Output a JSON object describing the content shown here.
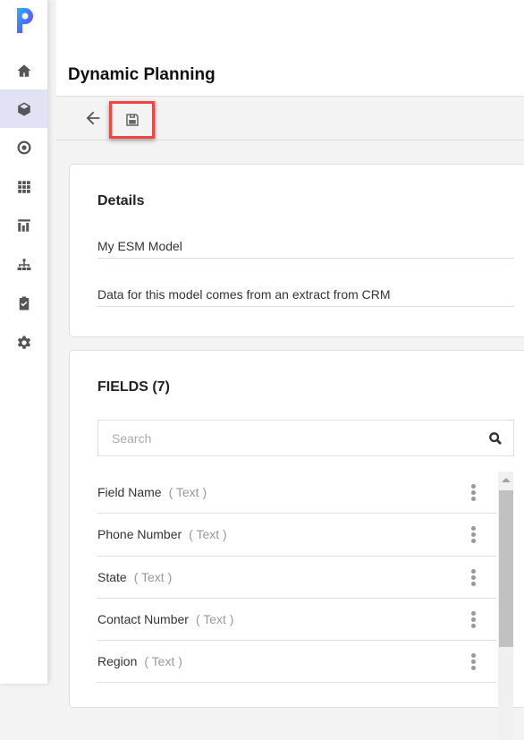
{
  "app": {
    "title": "Dynamic Planning",
    "accent": "#5b3df5"
  },
  "sidebar": {
    "items": [
      {
        "icon": "home-icon"
      },
      {
        "icon": "cube-icon",
        "active": true
      },
      {
        "icon": "target-icon"
      },
      {
        "icon": "grid-icon"
      },
      {
        "icon": "chart-icon"
      },
      {
        "icon": "hierarchy-icon"
      },
      {
        "icon": "clipboard-check-icon"
      },
      {
        "icon": "gear-icon"
      }
    ]
  },
  "toolbar": {
    "back": "arrow-left-icon",
    "save": "save-icon",
    "highlight": "#f04444"
  },
  "details": {
    "heading": "Details",
    "name": "My ESM Model",
    "description": "Data for this model comes from an extract from CRM"
  },
  "fields": {
    "heading": "FIELDS (7)",
    "search_placeholder": "Search",
    "items": [
      {
        "name": "Field Name",
        "type": "( Text )"
      },
      {
        "name": "Phone Number",
        "type": "( Text )"
      },
      {
        "name": "State",
        "type": "( Text )"
      },
      {
        "name": "Contact Number",
        "type": "( Text )"
      },
      {
        "name": "Region",
        "type": "( Text )"
      }
    ]
  }
}
